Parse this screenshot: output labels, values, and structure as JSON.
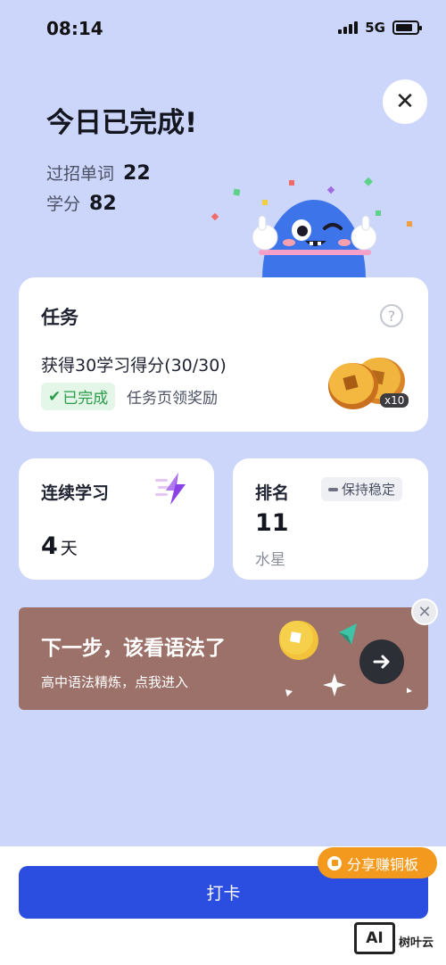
{
  "status_bar": {
    "time": "08:14",
    "network": "5G"
  },
  "header": {
    "title": "今日已完成!",
    "stats": [
      {
        "label": "过招单词",
        "value": "22"
      },
      {
        "label": "学分",
        "value": "82"
      }
    ]
  },
  "close_icon": "close-icon",
  "task_card": {
    "title": "任务",
    "help_icon": "question-circle-icon",
    "description": "获得30学习得分(30/30)",
    "badge": "已完成",
    "hint": "任务页领奖励",
    "reward_multiplier": "x10"
  },
  "streak_card": {
    "title": "连续学习",
    "value": "4",
    "unit": "天",
    "icon": "lightning-icon"
  },
  "rank_card": {
    "title": "排名",
    "badge": "保持稳定",
    "value": "11",
    "sub": "水星"
  },
  "next_card": {
    "title": "下一步，该看语法了",
    "subtitle": "高中语法精炼，点我进入",
    "action_icon": "arrow-right-icon"
  },
  "bottom": {
    "checkin_label": "打卡",
    "share_label": "分享赚铜板"
  },
  "watermark": {
    "logo_text": "AI",
    "name": "树叶云"
  },
  "colors": {
    "background": "#ccd6fb",
    "primary": "#2b4de0",
    "next_card": "#9c7169",
    "share_pill": "#f39a1e",
    "done_green": "#2a9b4a"
  }
}
